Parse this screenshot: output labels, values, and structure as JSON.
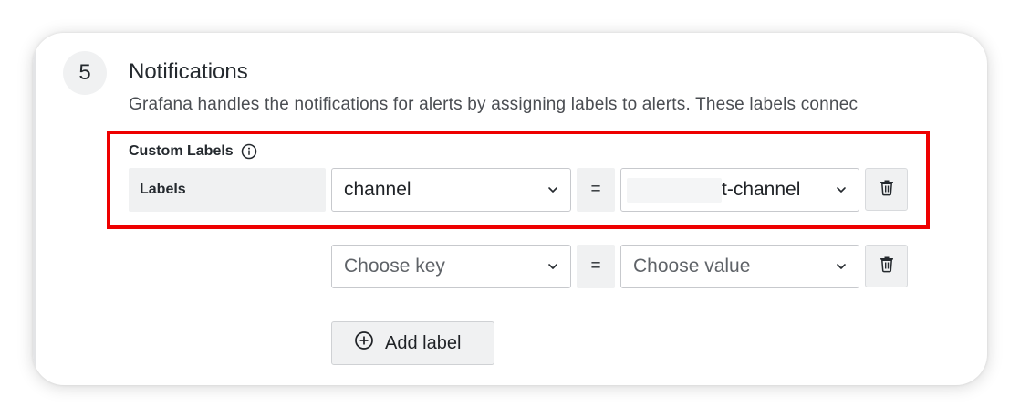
{
  "step": {
    "number": "5",
    "title": "Notifications",
    "description": "Grafana handles the notifications for alerts by assigning labels to alerts. These labels connec"
  },
  "custom_labels": {
    "title": "Custom Labels",
    "info_icon": "info-circle-icon",
    "labels_tag": "Labels",
    "rows": [
      {
        "key_value": "channel",
        "operator": "=",
        "value_text": "t-channel",
        "value_redacted": true
      },
      {
        "key_placeholder": "Choose key",
        "operator": "=",
        "value_placeholder": "Choose value"
      }
    ],
    "add_label": "Add label"
  },
  "icons": {
    "dropdown": "chevron-down-icon",
    "delete": "trash-icon",
    "add": "plus-circle-icon"
  },
  "colors": {
    "highlight": "#ee0000",
    "panel_grey": "#f0f1f2",
    "border": "#c7c9cd"
  }
}
